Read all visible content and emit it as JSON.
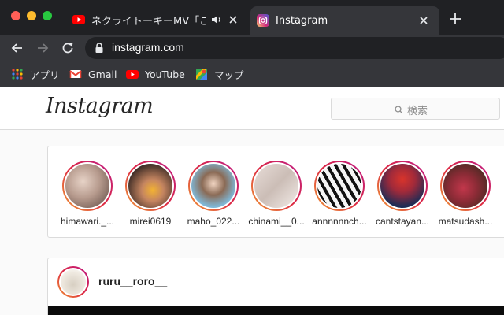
{
  "browser": {
    "tabs": [
      {
        "title": "ネクライトーキーMV「こんが",
        "favicon": "youtube-icon",
        "audio": true,
        "active": false
      },
      {
        "title": "Instagram",
        "favicon": "instagram-icon",
        "audio": false,
        "active": true
      }
    ],
    "url": "instagram.com",
    "bookmarks": [
      {
        "label": "アプリ",
        "icon": "apps-grid-icon"
      },
      {
        "label": "Gmail",
        "icon": "gmail-icon"
      },
      {
        "label": "YouTube",
        "icon": "youtube-icon"
      },
      {
        "label": "マップ",
        "icon": "maps-icon"
      }
    ]
  },
  "instagram": {
    "logo": "Instagram",
    "search_placeholder": "検索",
    "stories": [
      {
        "username": "himawari._..."
      },
      {
        "username": "mirei0619"
      },
      {
        "username": "maho_022..."
      },
      {
        "username": "chinami__0..."
      },
      {
        "username": "annnnnnch..."
      },
      {
        "username": "cantstayan..."
      },
      {
        "username": "matsudash..."
      }
    ],
    "post": {
      "username": "ruru__roro__"
    }
  },
  "colors": {
    "chrome_dark": "#202124",
    "chrome_toolbar": "#35363a",
    "story_ring": "#dc2743",
    "page_bg": "#fafafa"
  }
}
